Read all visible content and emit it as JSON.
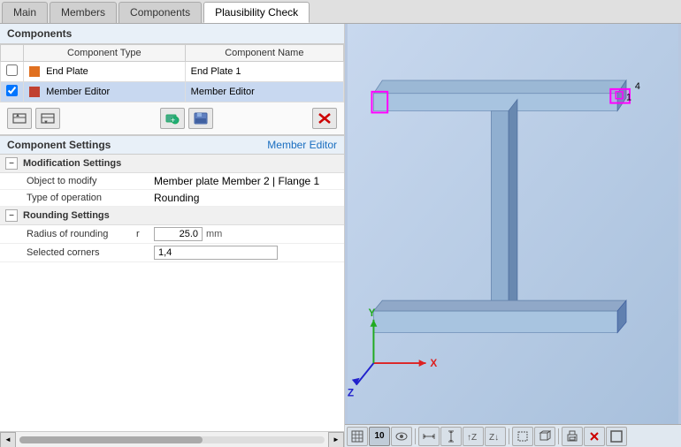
{
  "tabs": [
    {
      "label": "Main",
      "active": false
    },
    {
      "label": "Members",
      "active": false
    },
    {
      "label": "Components",
      "active": false
    },
    {
      "label": "Plausibility Check",
      "active": true
    }
  ],
  "left_panel": {
    "components_section": "Components",
    "table": {
      "headers": [
        "Component Type",
        "Component Name"
      ],
      "rows": [
        {
          "checked": false,
          "color": "#e07020",
          "type": "End Plate",
          "name": "End Plate 1",
          "selected": false
        },
        {
          "checked": true,
          "color": "#c04030",
          "type": "Member Editor",
          "name": "Member Editor",
          "selected": true
        }
      ]
    },
    "toolbar": {
      "btn1": "◄◄",
      "btn2": "◄",
      "btn3": "🔄",
      "btn4": "💾",
      "btn5": "✕"
    },
    "settings": {
      "title": "Component Settings",
      "name": "Member Editor",
      "groups": [
        {
          "label": "Modification Settings",
          "expanded": true,
          "rows": [
            {
              "label": "Object to modify",
              "key": "",
              "value": "Member plate  Member 2 | Flange 1"
            },
            {
              "label": "Type of operation",
              "key": "",
              "value": "Rounding"
            }
          ]
        },
        {
          "label": "Rounding Settings",
          "expanded": true,
          "rows": [
            {
              "label": "Radius of rounding",
              "key": "r",
              "value": "25.0",
              "unit": "mm",
              "has_input": true
            },
            {
              "label": "Selected corners",
              "key": "",
              "value": "1,4",
              "has_input": true
            }
          ]
        }
      ]
    }
  },
  "viewport": {
    "toolbar_buttons": [
      "⊞",
      "10",
      "👁",
      "⇔",
      "⇕",
      "⬆",
      "Z↑",
      "▭",
      "⬜",
      "🖨",
      "✕",
      "⊡"
    ]
  },
  "axes": {
    "x_label": "X",
    "y_label": "Y",
    "z_label": "Z"
  }
}
